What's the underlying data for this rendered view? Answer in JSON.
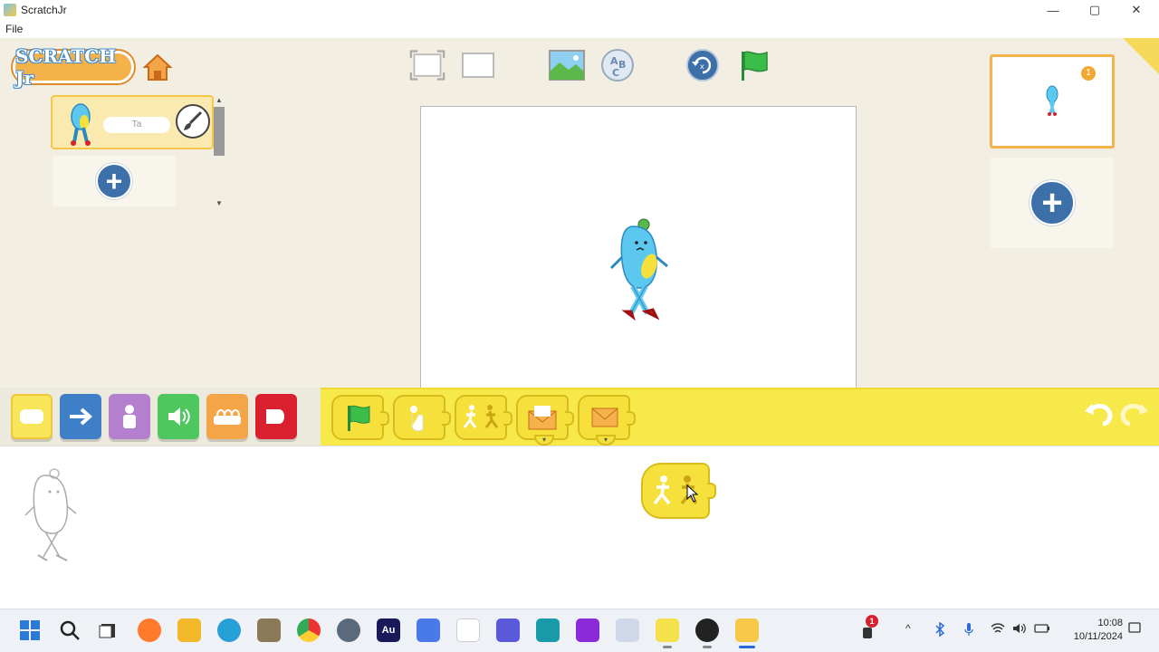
{
  "window": {
    "title": "ScratchJr",
    "menu": [
      "File"
    ],
    "controls": {
      "minimize": "—",
      "maximize": "▢",
      "close": "✕"
    }
  },
  "header": {
    "logo_text": "SCRATCH Jr",
    "home_icon": "home-icon",
    "fullscreen_icon": "fullscreen-icon",
    "grid_icon": "grid-icon",
    "background_icon": "background-icon",
    "text_icon": "text-icon",
    "reset_icon": "reset-icon",
    "green_flag_icon": "green-flag-icon"
  },
  "sprites": {
    "items": [
      {
        "name": "Ta"
      }
    ],
    "add_icon": "plus-icon"
  },
  "pages": {
    "items": [
      {
        "number": "1"
      }
    ],
    "add_icon": "plus-icon"
  },
  "palette": {
    "categories": [
      {
        "id": "triggering",
        "color": "#f8e55a",
        "icon": "trigger-icon"
      },
      {
        "id": "motion",
        "color": "#3f7fc7",
        "icon": "arrow-right-icon"
      },
      {
        "id": "looks",
        "color": "#b57fd0",
        "icon": "person-icon"
      },
      {
        "id": "sound",
        "color": "#4ec85e",
        "icon": "speaker-icon"
      },
      {
        "id": "control",
        "color": "#f4a548",
        "icon": "control-icon"
      },
      {
        "id": "end",
        "color": "#d8202e",
        "icon": "end-icon"
      }
    ],
    "blocks": [
      {
        "id": "start-on-green-flag",
        "icon": "green-flag-icon"
      },
      {
        "id": "start-on-tap",
        "icon": "tap-icon"
      },
      {
        "id": "start-on-bump",
        "icon": "bump-icon"
      },
      {
        "id": "send-message",
        "icon": "envelope-open-icon",
        "dropdown": "▾"
      },
      {
        "id": "start-on-message",
        "icon": "envelope-icon",
        "dropdown": "▾"
      }
    ]
  },
  "script": {
    "blocks": [
      {
        "id": "start-on-bump",
        "icon": "bump-icon"
      }
    ]
  },
  "taskbar": {
    "notification_count": "1",
    "time": "10:08",
    "date": "10/11/2024",
    "apps": [
      "start",
      "search",
      "task-view",
      "firefox",
      "file-explorer",
      "edge",
      "gimp",
      "chrome",
      "settings",
      "audition",
      "powerautomate",
      "notepad",
      "teams",
      "edu",
      "app-purple",
      "app-ghost",
      "app-sticky",
      "obs",
      "scratchjr"
    ]
  },
  "colors": {
    "stage_bg": "#ffffff",
    "palette_yellow": "#f8e94a",
    "accent_blue": "#3d6fa8",
    "card_border": "#f6b24a"
  }
}
